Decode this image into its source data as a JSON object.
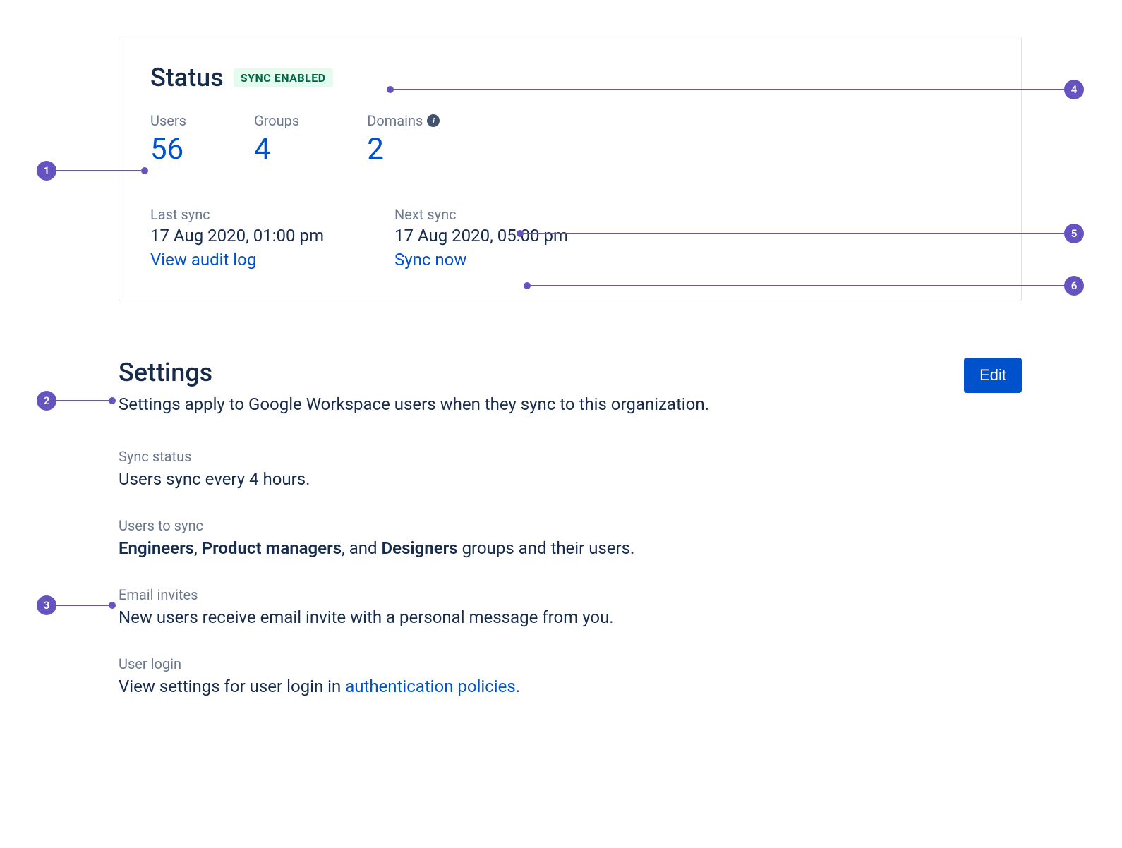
{
  "status": {
    "title": "Status",
    "badge": "SYNC ENABLED",
    "stats": {
      "users_label": "Users",
      "users_value": "56",
      "groups_label": "Groups",
      "groups_value": "4",
      "domains_label": "Domains",
      "domains_value": "2"
    },
    "last_sync": {
      "label": "Last sync",
      "value": "17 Aug 2020, 01:00 pm",
      "link": "View audit log"
    },
    "next_sync": {
      "label": "Next sync",
      "value": "17 Aug 2020, 05:00 pm",
      "link": "Sync now"
    }
  },
  "settings": {
    "title": "Settings",
    "edit_label": "Edit",
    "description": "Settings apply to Google Workspace users when they sync to this organization.",
    "sync_status": {
      "label": "Sync status",
      "value": "Users sync every 4 hours."
    },
    "users_to_sync": {
      "label": "Users to sync",
      "group1": "Engineers",
      "sep1": ", ",
      "group2": "Product managers",
      "sep2": ", and ",
      "group3": "Designers",
      "suffix": " groups and their users."
    },
    "email_invites": {
      "label": "Email invites",
      "value": "New users receive email invite with a personal message from you."
    },
    "user_login": {
      "label": "User login",
      "prefix": "View settings for user login in ",
      "link": "authentication policies",
      "suffix": "."
    }
  },
  "callouts": {
    "c1": "1",
    "c2": "2",
    "c3": "3",
    "c4": "4",
    "c5": "5",
    "c6": "6"
  }
}
